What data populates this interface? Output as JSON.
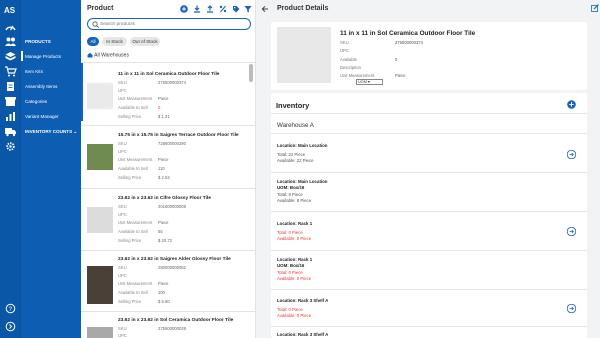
{
  "rail": {
    "icons": [
      "logo-icon",
      "dashboard-icon",
      "users-icon",
      "products-icon",
      "cart-icon",
      "orders-icon",
      "inventory-icon",
      "reports-icon",
      "truck-icon",
      "settings-icon",
      "help-icon",
      "expand-icon"
    ]
  },
  "sidebar": {
    "items": [
      {
        "label": "PRODUCTS"
      },
      {
        "label": "Manage Products"
      },
      {
        "label": "Item Kits"
      },
      {
        "label": "Assembly Items"
      },
      {
        "label": "Categories"
      },
      {
        "label": "Variant Manager"
      },
      {
        "label": "INVENTORY COUNTS"
      }
    ]
  },
  "product_list": {
    "title": "Product",
    "search_placeholder": "Search products",
    "filters": [
      "All",
      "In Stock",
      "Out of Stock"
    ],
    "warehouse": "All Warehouses",
    "field_labels": {
      "sku": "SKU",
      "upc": "UPC",
      "uom": "Unit Measurement",
      "available": "Available to Sell",
      "price": "Selling Price"
    },
    "items": [
      {
        "name": "11 in x 11 in Sol Ceramica Outdoor Floor Tile",
        "sku": "275500000374",
        "upc": "",
        "uom": "Piece",
        "available": "0",
        "price": "$ 1.31",
        "thumb": "#e8e8e8"
      },
      {
        "name": "15.75 in x 15.75 in Saigres Terrace Outdoor Floor Tile",
        "sku": "728600000290",
        "upc": "",
        "uom": "Piece",
        "available": "110",
        "price": "$ 2.53",
        "thumb": "#6f8b4f"
      },
      {
        "name": "23.62 in x 23.62 in Cifre Glossy Floor Tile",
        "sku": "201600000008",
        "upc": "",
        "uom": "Piece",
        "available": "55",
        "price": "$ 20.72",
        "thumb": "#dcdcdc"
      },
      {
        "name": "23.62 in x 23.62 in Saigres Alder Glossy Floor Tile",
        "sku": "280000000052",
        "upc": "",
        "uom": "Piece",
        "available": "100",
        "price": "$ 5.80",
        "thumb": "#4a4038"
      },
      {
        "name": "23.62 in x 23.62 in Sol Ceramica Outdoor Floor Tile",
        "sku": "275500000029",
        "upc": "",
        "uom": "Piece",
        "available": "",
        "price": "",
        "thumb": "#a9a9a9"
      }
    ]
  },
  "details": {
    "title": "Product Details",
    "product_name": "11 in x 11 in Sol Ceramica Outdoor Floor Tile",
    "labels": {
      "sku": "SKU",
      "upc": "UPC",
      "available": "Available",
      "description": "Description",
      "uom": "Unit Measurement"
    },
    "sku": "275500000374",
    "upc": "",
    "available": "0",
    "description": "",
    "uom": "Piece",
    "uom_select": "UOM",
    "inventory_title": "Inventory",
    "warehouse": "Warehouse A",
    "locations": [
      {
        "title": "Location: Main Location",
        "uom": "",
        "total": "Total: 22 Piece",
        "available": "Available: 22 Piece",
        "red": false,
        "has_arrow": true
      },
      {
        "title": "Location: Main Location",
        "uom": "UOM: Box/16",
        "total": "Total: 8 Piece",
        "available": "Available: 8 Piece",
        "red": false,
        "has_arrow": false
      },
      {
        "title": "Location: Rack 1",
        "uom": "",
        "total": "Total: 0 Piece",
        "available": "Available: 0 Piece",
        "red": true,
        "has_arrow": true
      },
      {
        "title": "Location: Rack 1",
        "uom": "UOM: Box/16",
        "total": "Total: 0 Piece",
        "available": "Available: 0 Piece",
        "red": true,
        "has_arrow": false
      },
      {
        "title": "Location: Rack 3 Shelf A",
        "uom": "",
        "total": "Total: 0 Piece",
        "available": "Available: 0 Piece",
        "red": true,
        "has_arrow": true
      },
      {
        "title": "Location: Rack 3 Shelf A",
        "uom": "",
        "total": "",
        "available": "",
        "red": false,
        "has_arrow": false
      }
    ]
  },
  "colors": {
    "rail": "#0a57a8",
    "sidebar": "#0d5db3",
    "accent": "#1565c0",
    "danger": "#e53935"
  }
}
